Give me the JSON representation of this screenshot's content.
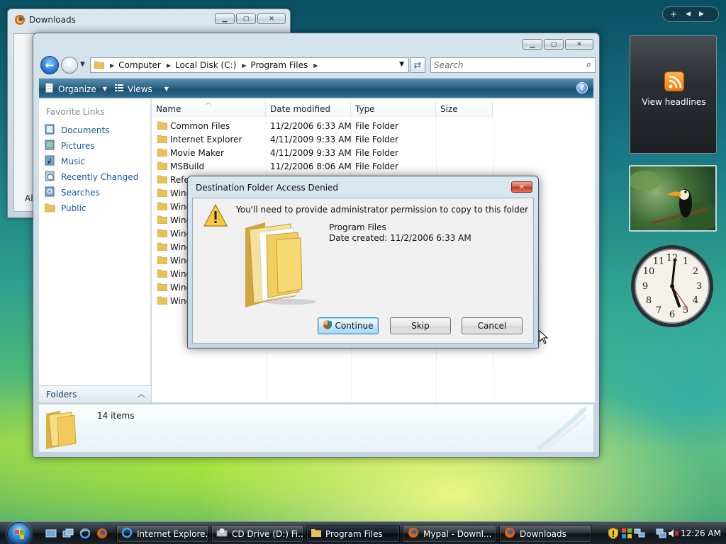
{
  "downloads_window": {
    "title": "Downloads",
    "side_text": "Al"
  },
  "explorer": {
    "address": [
      "Computer",
      "Local Disk (C:)",
      "Program Files"
    ],
    "search_placeholder": "Search",
    "toolbar": {
      "organize": "Organize",
      "views": "Views"
    },
    "favorite_links_header": "Favorite Links",
    "favorite_links": [
      "Documents",
      "Pictures",
      "Music",
      "Recently Changed",
      "Searches",
      "Public"
    ],
    "folders_label": "Folders",
    "columns": [
      "Name",
      "Date modified",
      "Type",
      "Size"
    ],
    "rows": [
      {
        "name": "Common Files",
        "date": "11/2/2006 6:33 AM",
        "type": "File Folder"
      },
      {
        "name": "Internet Explorer",
        "date": "4/11/2009 9:33 AM",
        "type": "File Folder"
      },
      {
        "name": "Movie Maker",
        "date": "4/11/2009 9:33 AM",
        "type": "File Folder"
      },
      {
        "name": "MSBuild",
        "date": "11/2/2006 8:06 AM",
        "type": "File Folder"
      },
      {
        "name": "Refe",
        "date": "",
        "type": ""
      },
      {
        "name": "Wind",
        "date": "",
        "type": ""
      },
      {
        "name": "Wind",
        "date": "",
        "type": ""
      },
      {
        "name": "Wind",
        "date": "",
        "type": ""
      },
      {
        "name": "Wind",
        "date": "",
        "type": ""
      },
      {
        "name": "Wind",
        "date": "",
        "type": ""
      },
      {
        "name": "Wind",
        "date": "",
        "type": ""
      },
      {
        "name": "Wind",
        "date": "",
        "type": ""
      },
      {
        "name": "Wind",
        "date": "",
        "type": ""
      },
      {
        "name": "Wind",
        "date": "",
        "type": ""
      }
    ],
    "item_count": "14 items"
  },
  "dialog": {
    "title": "Destination Folder Access Denied",
    "message": "You'll need to provide administrator permission to copy to this folder",
    "folder_name": "Program Files",
    "date_created": "Date created: 11/2/2006 6:33 AM",
    "buttons": {
      "continue": "Continue",
      "skip": "Skip",
      "cancel": "Cancel"
    }
  },
  "sidebar": {
    "top_plus": "+",
    "feed_label": "View headlines"
  },
  "taskbar": {
    "items": [
      "Internet Explore...",
      "CD Drive (D:) Fi...",
      "Program Files",
      "Mypal - Downl...",
      "Downloads"
    ],
    "time": "12:26 AM"
  },
  "colors": {
    "link": "#1a57a8",
    "toolbar": "#2b6587",
    "close_red": "#c03418",
    "folder": "#f2c94c"
  }
}
